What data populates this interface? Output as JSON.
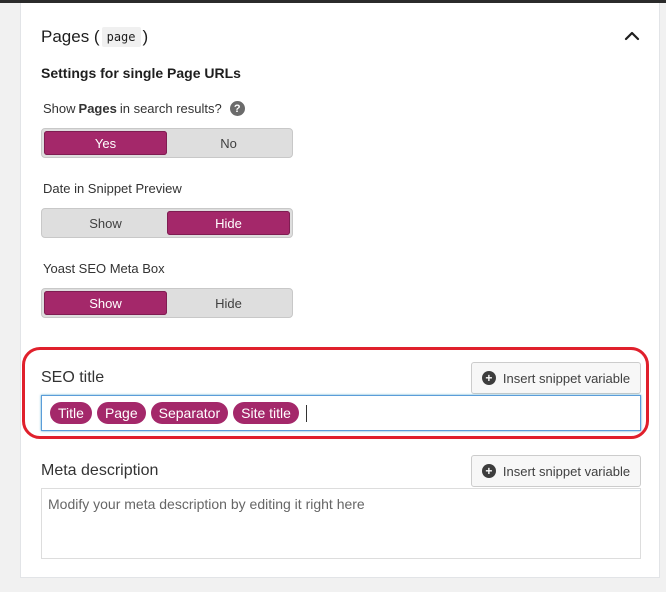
{
  "panel": {
    "title": "Pages (",
    "title_code": "page",
    "title_close": ")",
    "subheading": "Settings for single Page URLs"
  },
  "show_in_search": {
    "label_prefix": "Show",
    "label_bold": "Pages",
    "label_suffix": "in search results?",
    "options": [
      "Yes",
      "No"
    ],
    "selected": "Yes"
  },
  "date_in_snippet": {
    "label": "Date in Snippet Preview",
    "options": [
      "Show",
      "Hide"
    ],
    "selected": "Hide"
  },
  "meta_box": {
    "label": "Yoast SEO Meta Box",
    "options": [
      "Show",
      "Hide"
    ],
    "selected": "Show"
  },
  "seo_title": {
    "label": "SEO title",
    "insert_label": "Insert snippet variable",
    "pills": [
      "Title",
      "Page",
      "Separator",
      "Site title"
    ]
  },
  "meta_description": {
    "label": "Meta description",
    "insert_label": "Insert snippet variable",
    "placeholder": "Modify your meta description by editing it right here"
  },
  "colors": {
    "accent": "#a4286a",
    "highlight_border": "#e0202c"
  },
  "icons": {
    "collapse": "chevron-up-icon",
    "help": "help-icon",
    "plus": "plus-circle-icon"
  }
}
